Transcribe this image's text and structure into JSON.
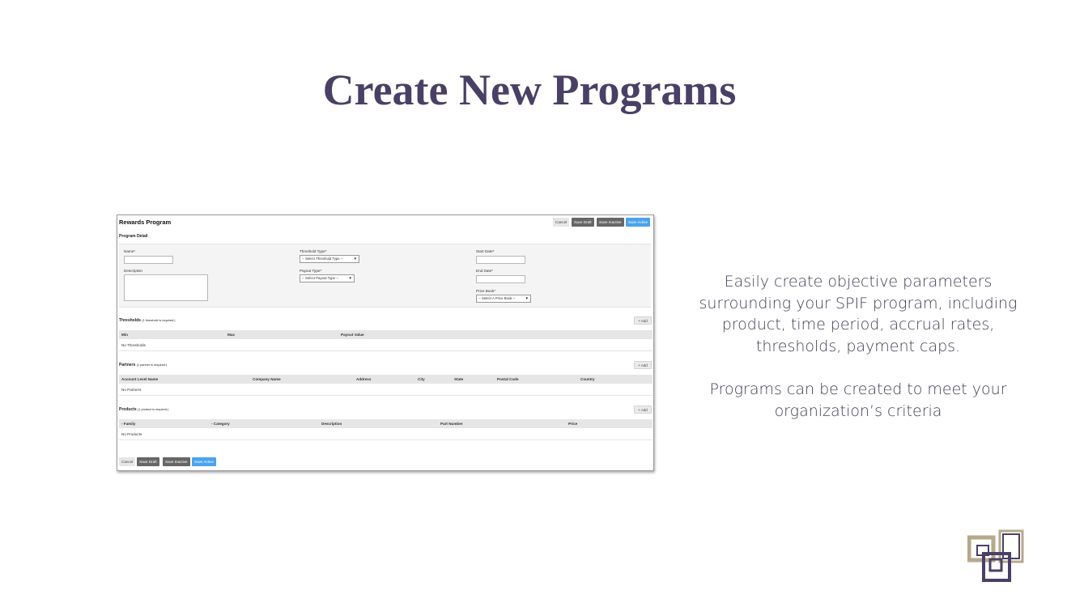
{
  "slide": {
    "title": "Create New Programs",
    "body_para1": "Easily create objective parameters surrounding your SPIF program, including product, time period, accrual rates, thresholds, payment caps.",
    "body_para2": "Programs can be created to meet your organization’s criteria"
  },
  "screenshot": {
    "title": "Rewards Program",
    "top_buttons": {
      "cancel": "Cancel",
      "save_draft": "Save Draft",
      "save_inactive": "Save Inactive",
      "save_active": "Save Active"
    },
    "program_detail": {
      "heading": "Program Detail",
      "name_label": "Name*",
      "name_value": "",
      "description_label": "Description",
      "description_value": "",
      "threshold_type_label": "Threshold Type*",
      "threshold_type_value": "-- Select Threshold Type --",
      "payout_type_label": "Payout Type*",
      "payout_type_value": "-- Select Payout Type --",
      "start_date_label": "Start Date*",
      "start_date_value": "",
      "end_date_label": "End Date*",
      "end_date_value": "",
      "price_book_label": "Price Book*",
      "price_book_value": "-- Select A Price Book --"
    },
    "thresholds": {
      "title": "Thresholds",
      "note": "(1 threshold is required.)",
      "add": "+ Add",
      "columns": [
        "Min",
        "Max",
        "Payout Value"
      ],
      "empty": "No Thresholds"
    },
    "partners": {
      "title": "Partners",
      "note": "(1 partner is required.)",
      "add": "+ Add",
      "columns": [
        "Account Level Name",
        "Company Name",
        "Address",
        "City",
        "State",
        "Postal Code",
        "Country"
      ],
      "empty": "No Partners"
    },
    "products": {
      "title": "Products",
      "note": "(1 product is required.)",
      "add": "+ Add",
      "columns": [
        "- Family",
        "- Category",
        "Description",
        "Part Number",
        "Price"
      ],
      "empty": "No Products"
    },
    "bottom_buttons": {
      "cancel": "Cancel",
      "save_draft": "Save Draft",
      "save_inactive": "Save Inactive",
      "save_active": "Save Active"
    }
  },
  "colors": {
    "title": "#4a4066",
    "body_text": "#3e3e52",
    "active_button": "#4aa3ee",
    "dark_button": "#666666",
    "logo_tan": "#b6a98a",
    "logo_purple": "#4a3f66"
  }
}
